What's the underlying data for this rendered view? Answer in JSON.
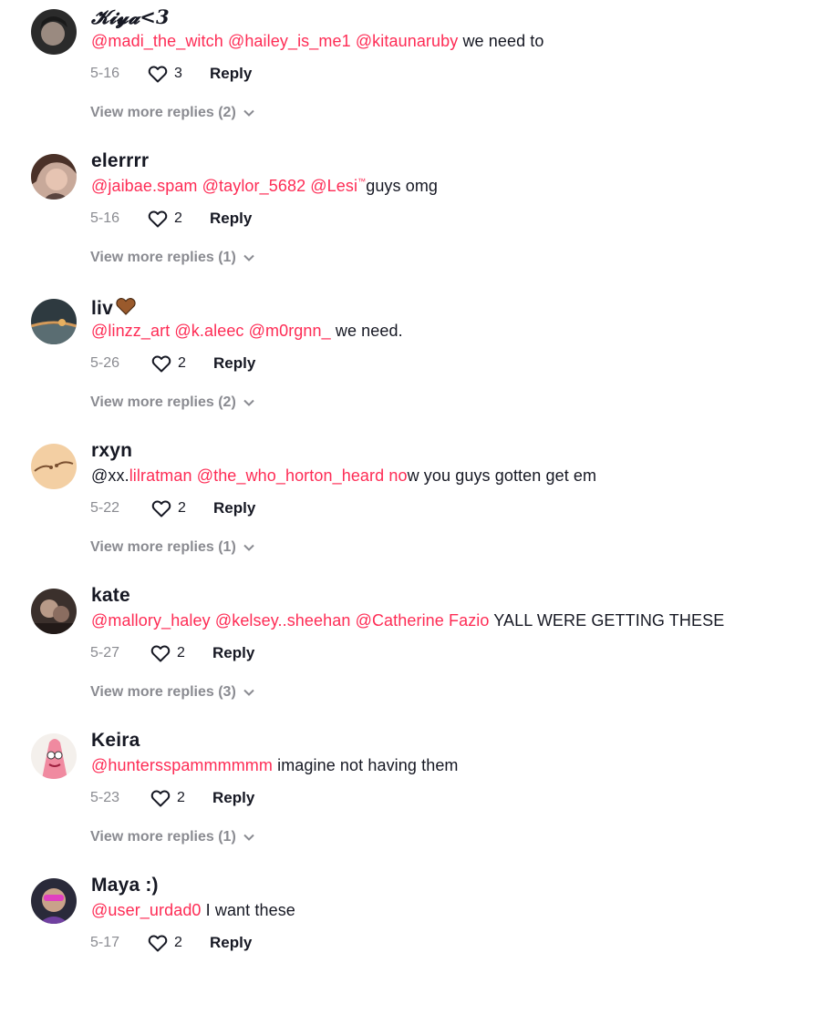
{
  "comments": [
    {
      "username": "𝓚𝓲𝔂𝓪<3",
      "text_parts": [
        {
          "t": "@madi_the_witch",
          "m": true
        },
        {
          "t": " ",
          "m": false
        },
        {
          "t": "@hailey_is_me1",
          "m": true
        },
        {
          "t": " ",
          "m": false
        },
        {
          "t": "@kitaunaruby",
          "m": true
        },
        {
          "t": " we need to",
          "m": false
        }
      ],
      "date": "5-16",
      "likes": "3",
      "reply_label": "Reply",
      "more_replies": "View more replies (2)"
    },
    {
      "username": "elerrrr",
      "text_parts": [
        {
          "t": "@jaibae.spam",
          "m": true
        },
        {
          "t": " ",
          "m": false
        },
        {
          "t": "@taylor_5682",
          "m": true
        },
        {
          "t": " ",
          "m": false
        },
        {
          "t": "@Lesi",
          "m": true
        },
        {
          "t": "™",
          "m": true,
          "sup": true
        },
        {
          "t": "guys omg",
          "m": false
        }
      ],
      "date": "5-16",
      "likes": "2",
      "reply_label": "Reply",
      "more_replies": "View more replies (1)"
    },
    {
      "username": "liv",
      "text_parts": [
        {
          "t": "@linzz_art",
          "m": true
        },
        {
          "t": " ",
          "m": false
        },
        {
          "t": "@k.aleec",
          "m": true
        },
        {
          "t": " ",
          "m": false
        },
        {
          "t": "@m0rgnn_",
          "m": true
        },
        {
          "t": " we need.",
          "m": false
        }
      ],
      "date": "5-26",
      "likes": "2",
      "reply_label": "Reply",
      "more_replies": "View more replies (2)"
    },
    {
      "username": "rxyn",
      "text_parts": [
        {
          "t": "@xx.",
          "m": false
        },
        {
          "t": "lilratman",
          "m": true
        },
        {
          "t": " ",
          "m": false
        },
        {
          "t": "@the_who_horton_heard",
          "m": true
        },
        {
          "t": " ",
          "m": false
        },
        {
          "t": "no",
          "m": true
        },
        {
          "t": "w you guys gotten get em",
          "m": false
        }
      ],
      "date": "5-22",
      "likes": "2",
      "reply_label": "Reply",
      "more_replies": "View more replies (1)"
    },
    {
      "username": "kate",
      "text_parts": [
        {
          "t": "@mallory_haley",
          "m": true
        },
        {
          "t": " ",
          "m": false
        },
        {
          "t": "@kelsey..sheehan",
          "m": true
        },
        {
          "t": " ",
          "m": false
        },
        {
          "t": "@Catherine Fazio",
          "m": true
        },
        {
          "t": " YALL WERE GETTING THESE",
          "m": false
        }
      ],
      "date": "5-27",
      "likes": "2",
      "reply_label": "Reply",
      "more_replies": "View more replies (3)"
    },
    {
      "username": "Keira",
      "text_parts": [
        {
          "t": "@huntersspammmmmm",
          "m": true
        },
        {
          "t": " imagine not having them",
          "m": false
        }
      ],
      "date": "5-23",
      "likes": "2",
      "reply_label": "Reply",
      "more_replies": "View more replies (1)"
    },
    {
      "username": "Maya :)",
      "text_parts": [
        {
          "t": "@user_urdad0",
          "m": true
        },
        {
          "t": " I want these",
          "m": false
        }
      ],
      "date": "5-17",
      "likes": "2",
      "reply_label": "Reply"
    }
  ],
  "colors": {
    "mention": "#fe2c55",
    "muted": "#8a8b91",
    "text": "#161823"
  }
}
